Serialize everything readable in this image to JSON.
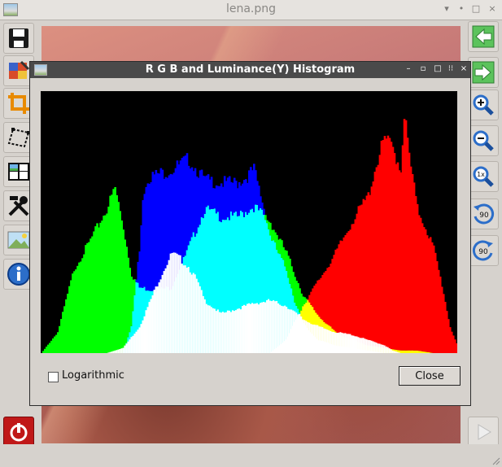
{
  "window": {
    "title": "lena.png",
    "controls": [
      "▾",
      "•",
      "□",
      "×"
    ]
  },
  "left_toolbar": [
    {
      "name": "save-icon"
    },
    {
      "name": "adjust-colors-icon"
    },
    {
      "name": "crop-icon"
    },
    {
      "name": "perspective-icon"
    },
    {
      "name": "histogram-icon"
    },
    {
      "name": "tools-icon"
    },
    {
      "name": "image-info-icon"
    },
    {
      "name": "info-icon"
    }
  ],
  "right_toolbar": {
    "rotate_left_label": "90",
    "rotate_right_label": "90",
    "zoom_1x_label": "1x"
  },
  "dialog": {
    "title": "R G B and Luminance(Y) Histogram",
    "controls": [
      "–",
      "▫",
      "□",
      "⁝⁝",
      "×"
    ],
    "logarithmic_label": "Logarithmic",
    "logarithmic_checked": false,
    "close_label": "Close"
  },
  "chart_data": {
    "type": "area",
    "xlim": [
      0,
      255
    ],
    "ylim": [
      0,
      1
    ],
    "grid": false,
    "colors": {
      "red": "#ff0000",
      "green": "#00ff00",
      "blue": "#0000ff",
      "luminance": "#ffffff",
      "red_green": "#ffff00",
      "green_blue": "#00ffff",
      "red_blue": "#ff00ff"
    },
    "series": [
      {
        "color": "green",
        "x": [
          0,
          10,
          20,
          30,
          40,
          45,
          50,
          55,
          60,
          70,
          80,
          90,
          100,
          110,
          120,
          130,
          140,
          150,
          160,
          170,
          180,
          190,
          200,
          210,
          220,
          230,
          240,
          255
        ],
        "y": [
          0.0,
          0.08,
          0.32,
          0.43,
          0.55,
          0.63,
          0.48,
          0.3,
          0.25,
          0.24,
          0.25,
          0.4,
          0.55,
          0.52,
          0.52,
          0.56,
          0.5,
          0.38,
          0.22,
          0.14,
          0.08,
          0.05,
          0.03,
          0.02,
          0.01,
          0.01,
          0.0,
          0.0
        ]
      },
      {
        "color": "blue",
        "x": [
          0,
          40,
          50,
          55,
          60,
          62,
          65,
          70,
          80,
          90,
          100,
          110,
          120,
          125,
          130,
          135,
          140,
          145,
          150,
          155,
          160,
          165,
          170,
          180,
          190,
          200,
          210,
          255
        ],
        "y": [
          0.0,
          0.0,
          0.0,
          0.1,
          0.4,
          0.6,
          0.67,
          0.68,
          0.7,
          0.74,
          0.66,
          0.65,
          0.65,
          0.67,
          0.7,
          0.58,
          0.45,
          0.38,
          0.32,
          0.2,
          0.12,
          0.08,
          0.05,
          0.03,
          0.02,
          0.01,
          0.0,
          0.0
        ]
      },
      {
        "color": "red",
        "x": [
          0,
          140,
          150,
          160,
          170,
          180,
          190,
          200,
          205,
          210,
          215,
          220,
          222,
          225,
          230,
          235,
          240,
          245,
          250,
          255
        ],
        "y": [
          0.0,
          0.0,
          0.05,
          0.18,
          0.28,
          0.38,
          0.5,
          0.6,
          0.72,
          0.82,
          0.78,
          0.7,
          0.92,
          0.75,
          0.55,
          0.48,
          0.4,
          0.26,
          0.1,
          0.02
        ]
      },
      {
        "color": "luminance",
        "x": [
          0,
          40,
          50,
          60,
          70,
          75,
          80,
          85,
          90,
          95,
          100,
          110,
          120,
          130,
          140,
          150,
          160,
          170,
          180,
          190,
          200,
          210,
          215,
          220,
          255
        ],
        "y": [
          0.0,
          0.0,
          0.02,
          0.1,
          0.25,
          0.32,
          0.38,
          0.36,
          0.33,
          0.28,
          0.2,
          0.15,
          0.17,
          0.19,
          0.2,
          0.18,
          0.13,
          0.1,
          0.08,
          0.07,
          0.05,
          0.03,
          0.01,
          0.0,
          0.0
        ]
      }
    ]
  }
}
